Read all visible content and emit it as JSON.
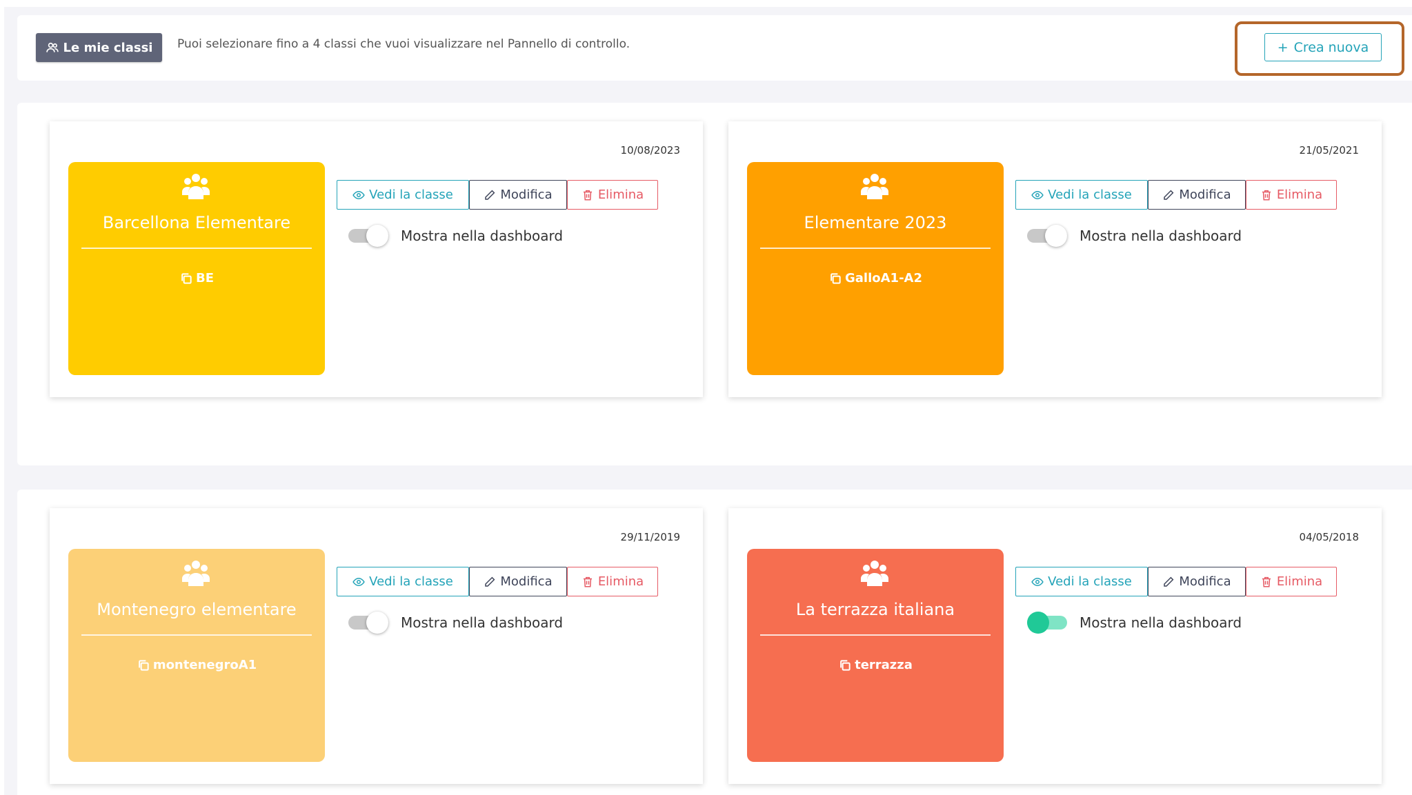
{
  "header": {
    "badge_label": "Le mie classi",
    "info_text": "Puoi selezionare fino a 4 classi che vuoi visualizzare nel Pannello di controllo.",
    "create_label": "Crea nuova"
  },
  "colors": {
    "badge": "#5f6478",
    "accent": "#23a3b8",
    "edit": "#3e4459",
    "delete": "#e65a64",
    "highlight": "#b4662a",
    "toggle_on": "#20c997"
  },
  "classes": [
    {
      "date": "10/08/2023",
      "name": "Barcellona Elementare",
      "code": "BE",
      "color": "#ffcc00",
      "view_label": "Vedi la classe",
      "edit_label": "Modifica",
      "delete_label": "Elimina",
      "toggle_label": "Mostra nella dashboard",
      "show_in_dashboard": false
    },
    {
      "date": "21/05/2021",
      "name": "Elementare 2023",
      "code": "GalloA1-A2",
      "color": "#ffa000",
      "view_label": "Vedi la classe",
      "edit_label": "Modifica",
      "delete_label": "Elimina",
      "toggle_label": "Mostra nella dashboard",
      "show_in_dashboard": false
    },
    {
      "date": "29/11/2019",
      "name": "Montenegro elementare",
      "code": "montenegroA1",
      "color": "#fcd077",
      "view_label": "Vedi la classe",
      "edit_label": "Modifica",
      "delete_label": "Elimina",
      "toggle_label": "Mostra nella dashboard",
      "show_in_dashboard": false
    },
    {
      "date": "04/05/2018",
      "name": "La terrazza italiana",
      "code": "terrazza",
      "color": "#f66e50",
      "view_label": "Vedi la classe",
      "edit_label": "Modifica",
      "delete_label": "Elimina",
      "toggle_label": "Mostra nella dashboard",
      "show_in_dashboard": true
    }
  ]
}
